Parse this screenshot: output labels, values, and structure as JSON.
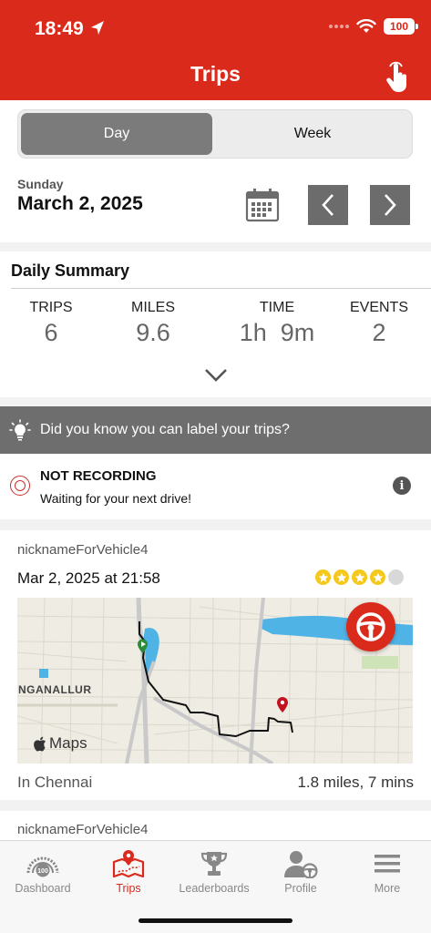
{
  "status_bar": {
    "time": "18:49",
    "battery": "100"
  },
  "header": {
    "title": "Trips"
  },
  "segment": {
    "day_label": "Day",
    "week_label": "Week",
    "selected": "Day"
  },
  "date": {
    "weekday": "Sunday",
    "full": "March 2, 2025"
  },
  "summary": {
    "title": "Daily Summary",
    "stats": [
      {
        "label": "TRIPS",
        "value": "6"
      },
      {
        "label": "MILES",
        "value": "9.6"
      },
      {
        "label": "TIME",
        "value": "1h  9m"
      },
      {
        "label": "EVENTS",
        "value": "2"
      }
    ]
  },
  "tip": {
    "text": "Did you know you can label your trips?"
  },
  "recording": {
    "title": "NOT RECORDING",
    "subtitle": "Waiting for your next drive!"
  },
  "trips": [
    {
      "vehicle": "nicknameForVehicle4",
      "datetime": "Mar 2, 2025 at 21:58",
      "rating": 4,
      "rating_max": 5,
      "map_place_label": "NGANALLUR",
      "map_logo": "Maps",
      "location": "In Chennai",
      "distance_time": "1.8 miles, 7 mins"
    },
    {
      "vehicle": "nicknameForVehicle4"
    }
  ],
  "tabbar": {
    "items": [
      {
        "label": "Dashboard",
        "icon": "speedometer-icon",
        "active": false
      },
      {
        "label": "Trips",
        "icon": "map-pin-icon",
        "active": true
      },
      {
        "label": "Leaderboards",
        "icon": "trophy-icon",
        "active": false
      },
      {
        "label": "Profile",
        "icon": "driver-profile-icon",
        "active": false
      },
      {
        "label": "More",
        "icon": "menu-icon",
        "active": false
      }
    ]
  },
  "colors": {
    "brand_red": "#d92a1c",
    "segment_active": "#7b7b7b",
    "star": "#f4c91c",
    "route": "#111111",
    "water": "#4fb3e6"
  }
}
